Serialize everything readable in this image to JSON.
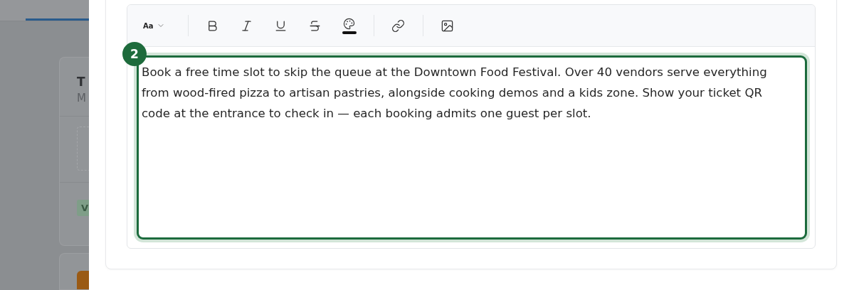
{
  "background_page": {
    "tab_underline": true,
    "card": {
      "title": "T",
      "subtitle": "M",
      "tag": "V"
    }
  },
  "editor": {
    "toolbar": [
      {
        "kind": "textsize",
        "label": "Aa"
      },
      {
        "kind": "separator"
      },
      {
        "kind": "bold"
      },
      {
        "kind": "italic"
      },
      {
        "kind": "underline"
      },
      {
        "kind": "strike"
      },
      {
        "kind": "color",
        "color": "#111111"
      },
      {
        "kind": "separator"
      },
      {
        "kind": "link"
      },
      {
        "kind": "separator"
      },
      {
        "kind": "image"
      }
    ],
    "step_badge": "2",
    "focused": true,
    "content": "Book a free time slot to skip the queue at the Downtown Food Festival. Over 40 vendors serve everything from wood-fired pizza to artisan pastries, alongside cooking demos and a kids zone. Show your ticket QR code at the entrance to check in — each booking admits one guest per slot."
  }
}
